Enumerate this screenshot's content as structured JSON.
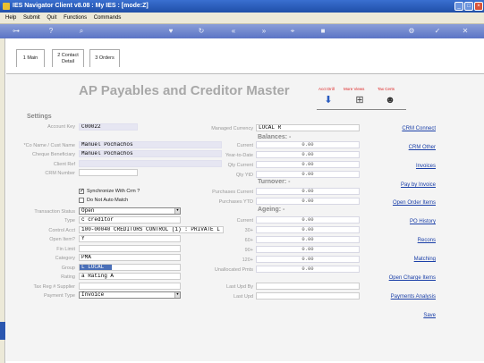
{
  "window": {
    "title": "IES Navigator Client v8.08 : My IES :   [mode:Z]"
  },
  "menu": [
    "Help",
    "Submit",
    "Quit",
    "Functions",
    "Commands"
  ],
  "tabs": [
    {
      "label": "1 Main"
    },
    {
      "label": "2 Contact Detail"
    },
    {
      "label": "3 Orders"
    }
  ],
  "page": {
    "title": "AP Payables and Creditor Master"
  },
  "toolbar_buttons": {
    "acct_drill": "Acct Drill",
    "more_views": "More Views",
    "tax_certs": "Tax Certs"
  },
  "settings": {
    "section": "Settings",
    "account_key_label": "Account Key",
    "account_key": "C00022",
    "name_label": "*Co Name / Cust Name",
    "name": "Manuel Pochachos",
    "cheque_label": "Cheque Beneficiary",
    "cheque": "Manuel Pochachos",
    "client_ref_label": "Client Ref",
    "client_ref": "",
    "crm_label": "CRM Number",
    "crm": "",
    "sync_label": "Synchronize With Crm ?",
    "no_auto_label": "Do Not Auto Match",
    "txn_status_label": "Transaction Status",
    "txn_status": "Open",
    "type_label": "Type",
    "type": "c creditor",
    "control_label": "Control Acct",
    "control": "100-00040 CREDITORS CONTROL (1) : PRIVATE L",
    "open_item_label": "Open Item?",
    "open_item": "Y",
    "fin_limit_label": "Fin Limit",
    "fin_limit": "",
    "category_label": "Category",
    "category": "PMA",
    "group_label": "Group",
    "group": "L LOCAL",
    "rating_label": "Rating",
    "rating": "a Rating A",
    "tax_reg_label": "Tax Reg # Supplier",
    "tax_reg": "",
    "payment_label": "Payment Type",
    "payment": "Invoice"
  },
  "middle": {
    "managed_currency_label": "Managed Currency",
    "managed_currency": "LOCAL R",
    "balances_section": "Balances: -",
    "balances": [
      {
        "label": "Current",
        "value": "0.00"
      },
      {
        "label": "Year-to-Date",
        "value": "0.00"
      },
      {
        "label": "Qty Current",
        "value": "0.00"
      },
      {
        "label": "Qty YtD",
        "value": "0.00"
      }
    ],
    "turnover_section": "Turnover: -",
    "turnover": [
      {
        "label": "Purchases Current",
        "value": "0.00"
      },
      {
        "label": "Purchases YTD",
        "value": "0.00"
      }
    ],
    "ageing_section": "Ageing: -",
    "ageing": [
      {
        "label": "Current",
        "value": "0.00"
      },
      {
        "label": "30+",
        "value": "0.00"
      },
      {
        "label": "60+",
        "value": "0.00"
      },
      {
        "label": "90+",
        "value": "0.00"
      },
      {
        "label": "120+",
        "value": "0.00"
      },
      {
        "label": "Unallocated Pmts",
        "value": "0.00"
      }
    ],
    "last_upd_by_label": "Last Upd By",
    "last_upd_by": "",
    "last_upd_label": "Last Upd",
    "last_upd": ""
  },
  "links": [
    "CRM Connect",
    "CRM Other",
    "Invoices",
    "Pay by Invoice",
    "Open Order Items",
    "PO History",
    "Recons",
    "Matching",
    "Open Charge Items",
    "Payments Analysis",
    "Save"
  ]
}
